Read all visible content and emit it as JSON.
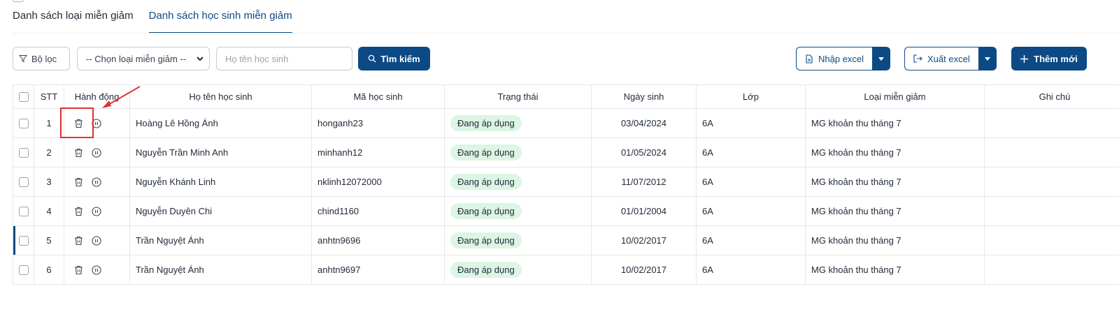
{
  "tabs": [
    {
      "label": "Danh sách loại miễn giảm",
      "active": false
    },
    {
      "label": "Danh sách học sinh miễn giảm",
      "active": true
    }
  ],
  "toolbar": {
    "filter_label": "Bộ lọc",
    "select_value": "-- Chọn loại miễn giảm --",
    "search_placeholder": "Họ tên học sinh",
    "search_button": "Tìm kiếm",
    "import_label": "Nhập excel",
    "export_label": "Xuất excel",
    "add_label": "Thêm mới"
  },
  "table": {
    "columns": [
      "STT",
      "Hành động",
      "Họ tên học sinh",
      "Mã học sinh",
      "Trạng thái",
      "Ngày sinh",
      "Lớp",
      "Loại miễn giảm",
      "Ghi chú"
    ],
    "rows": [
      {
        "stt": "1",
        "name": "Hoàng Lê Hồng Ánh",
        "code": "honganh23",
        "status": "Đang áp dụng",
        "dob": "03/04/2024",
        "class": "6A",
        "type": "MG khoản thu tháng 7",
        "note": ""
      },
      {
        "stt": "2",
        "name": "Nguyễn Trần Minh Anh",
        "code": "minhanh12",
        "status": "Đang áp dụng",
        "dob": "01/05/2024",
        "class": "6A",
        "type": "MG khoản thu tháng 7",
        "note": ""
      },
      {
        "stt": "3",
        "name": "Nguyễn Khánh Linh",
        "code": "nklinh12072000",
        "status": "Đang áp dụng",
        "dob": "11/07/2012",
        "class": "6A",
        "type": "MG khoản thu tháng 7",
        "note": ""
      },
      {
        "stt": "4",
        "name": "Nguyễn Duyên Chi",
        "code": "chind1160",
        "status": "Đang áp dụng",
        "dob": "01/01/2004",
        "class": "6A",
        "type": "MG khoản thu tháng 7",
        "note": ""
      },
      {
        "stt": "5",
        "name": "Trần Nguyệt Ánh",
        "code": "anhtn9696",
        "status": "Đang áp dụng",
        "dob": "10/02/2017",
        "class": "6A",
        "type": "MG khoản thu tháng 7",
        "note": ""
      },
      {
        "stt": "6",
        "name": "Trần Nguyệt Ánh",
        "code": "anhtn9697",
        "status": "Đang áp dụng",
        "dob": "10/02/2017",
        "class": "6A",
        "type": "MG khoản thu tháng 7",
        "note": ""
      }
    ]
  },
  "colors": {
    "primary": "#0d4a85",
    "badge_bg": "#dcf5e4",
    "highlight": "#e03131"
  }
}
